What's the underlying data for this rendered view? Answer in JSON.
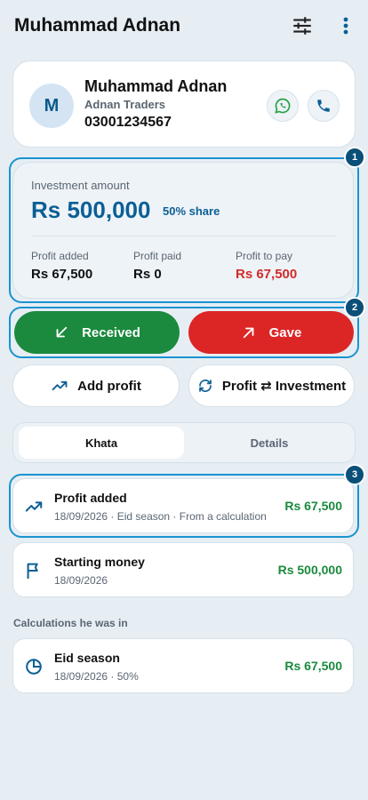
{
  "appbar": {
    "title": "Muhammad Adnan"
  },
  "profile": {
    "avatar_letter": "M",
    "name": "Muhammad Adnan",
    "business": "Adnan Traders",
    "phone": "03001234567"
  },
  "investment": {
    "label": "Investment amount",
    "amount": "Rs 500,000",
    "share": "50% share",
    "stats": [
      {
        "label": "Profit added",
        "value": "Rs 67,500"
      },
      {
        "label": "Profit paid",
        "value": "Rs 0"
      },
      {
        "label": "Profit to pay",
        "value": "Rs 67,500",
        "color": "#d32a2a"
      }
    ]
  },
  "actions": {
    "received_label": "Received",
    "gave_label": "Gave",
    "add_profit_label": "Add profit",
    "profit_investment_label": "Profit ⇄ Investment"
  },
  "tabs": [
    {
      "label": "Khata",
      "active": true
    },
    {
      "label": "Details",
      "active": false
    }
  ],
  "entries": [
    {
      "title": "Profit added",
      "subtitle": "18/09/2026 · Eid season · From a calculation",
      "amount": "Rs 67,500",
      "icon": "trending-up-icon"
    },
    {
      "title": "Starting money",
      "subtitle": "18/09/2026",
      "amount": "Rs 500,000",
      "icon": "flag-icon"
    }
  ],
  "calculations": {
    "section_title": "Calculations he was in",
    "items": [
      {
        "title": "Eid season",
        "subtitle": "18/09/2026 · 50%",
        "amount": "Rs 67,500",
        "icon": "pie-chart-icon"
      }
    ]
  },
  "markers": [
    "1",
    "2",
    "3"
  ],
  "colors": {
    "brand": "#0b5f95",
    "positive": "#1b8a3e",
    "negative": "#dc2626",
    "highlight": "#1a93d0",
    "marker": "#0a4f78",
    "background": "#e6eef4"
  }
}
